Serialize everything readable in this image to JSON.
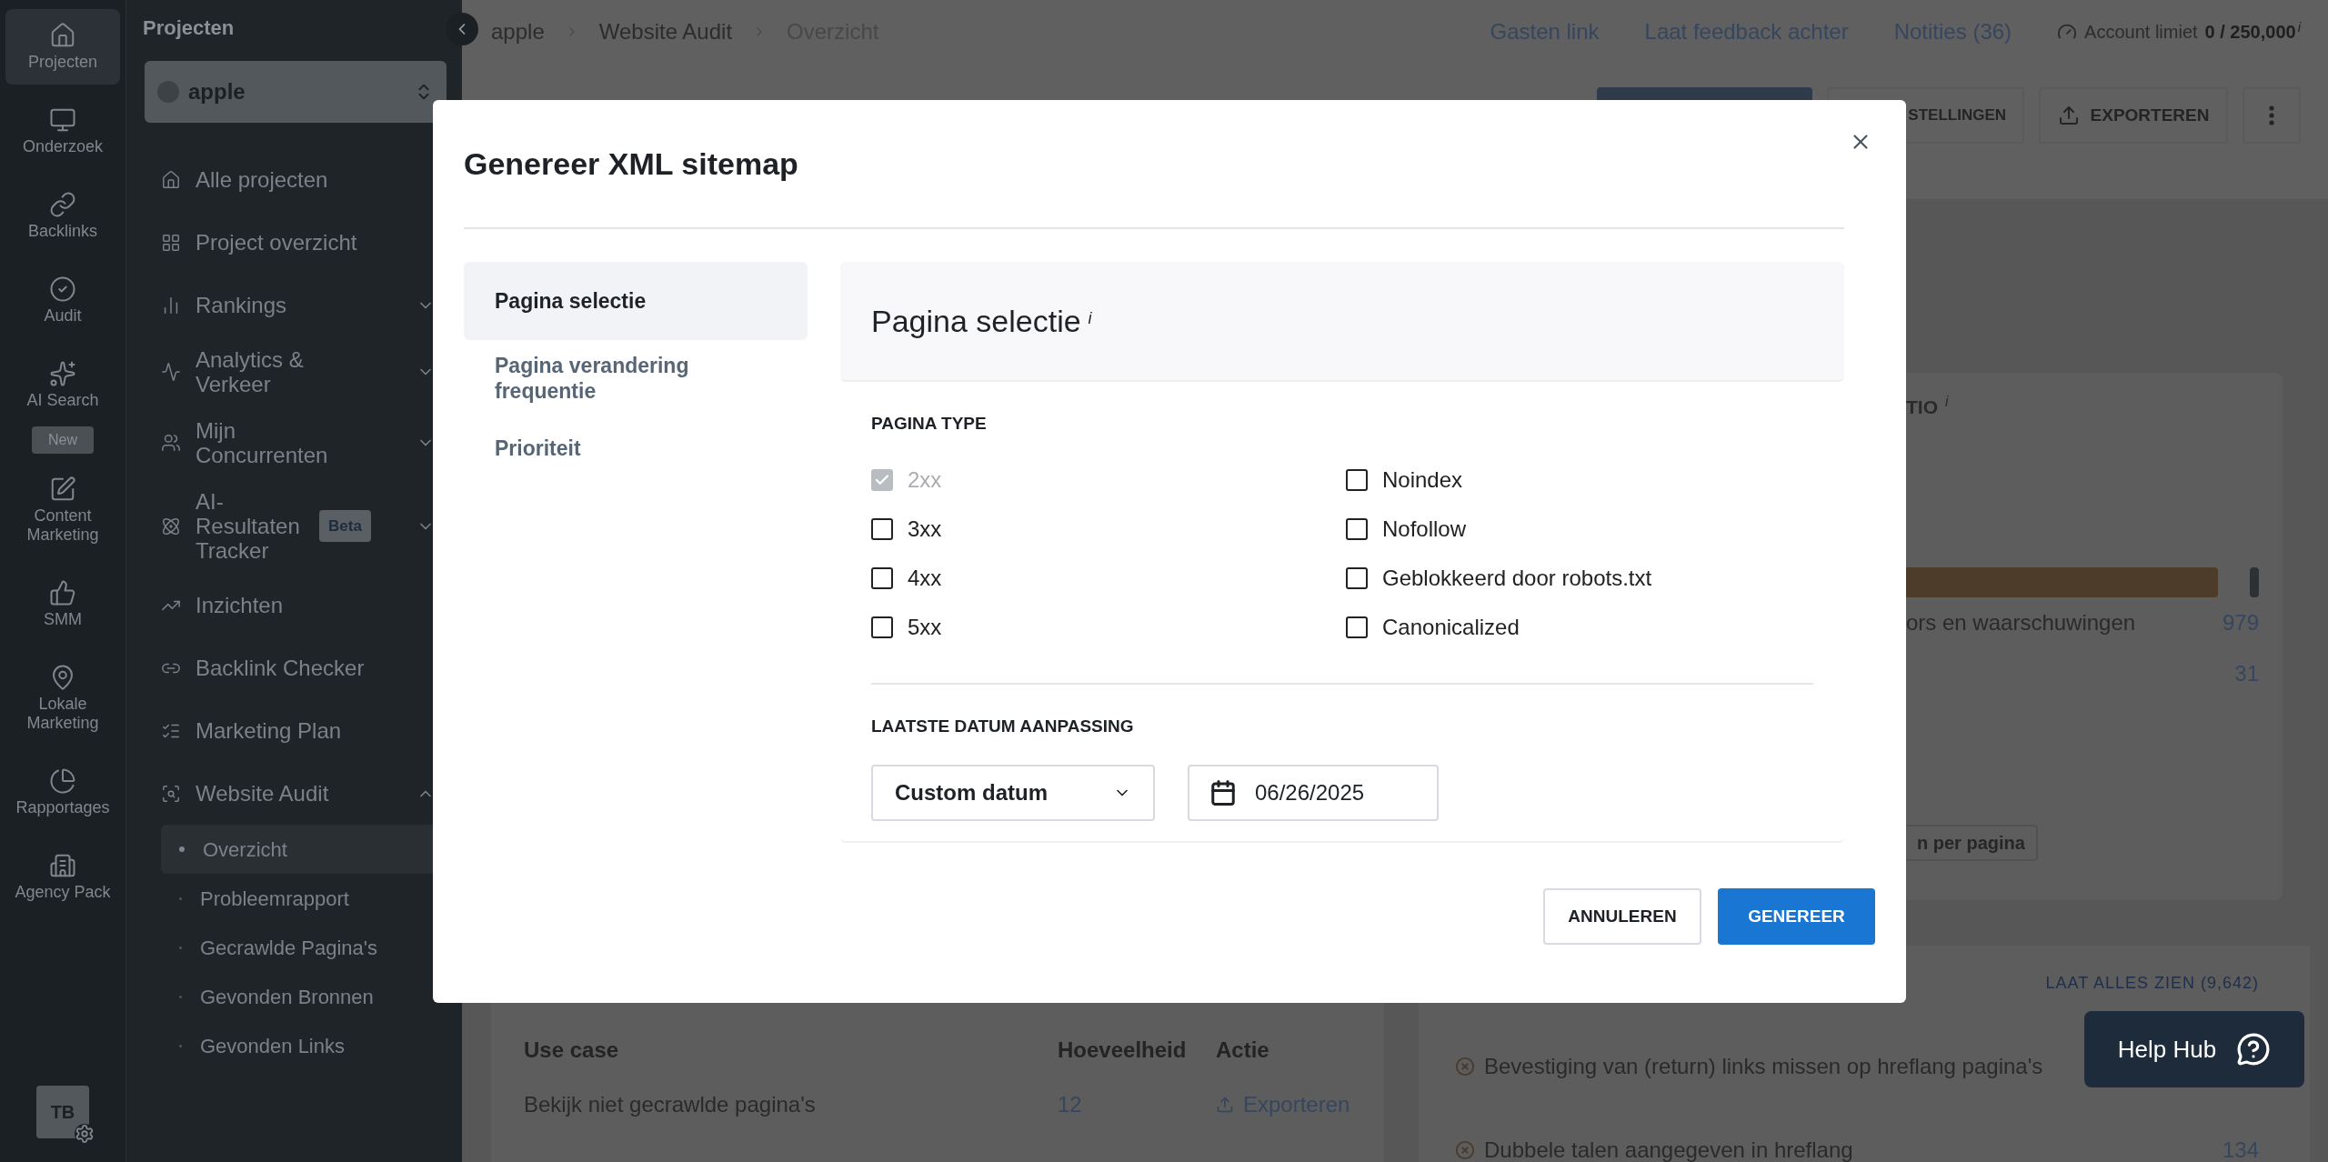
{
  "icon_rail": {
    "items": [
      {
        "label": "Projecten",
        "selected": true
      },
      {
        "label": "Onderzoek",
        "selected": false
      },
      {
        "label": "Backlinks",
        "selected": false
      },
      {
        "label": "Audit",
        "selected": false
      },
      {
        "label": "AI Search",
        "selected": false,
        "badge": "New"
      },
      {
        "label": "Content Marketing",
        "selected": false
      },
      {
        "label": "SMM",
        "selected": false
      },
      {
        "label": "Lokale Marketing",
        "selected": false
      },
      {
        "label": "Rapportages",
        "selected": false
      },
      {
        "label": "Agency Pack",
        "selected": false
      }
    ],
    "avatar": "TB"
  },
  "nav": {
    "title": "Projecten",
    "project": "apple",
    "items": [
      {
        "label": "Alle projecten"
      },
      {
        "label": "Project overzicht"
      },
      {
        "label": "Rankings",
        "expanded": false
      },
      {
        "label": "Analytics & Verkeer",
        "expanded": false
      },
      {
        "label": "Mijn Concurrenten",
        "expanded": false
      },
      {
        "label": "AI-Resultaten Tracker",
        "expanded": false,
        "badge": "Beta"
      },
      {
        "label": "Inzichten"
      },
      {
        "label": "Backlink Checker"
      },
      {
        "label": "Marketing Plan"
      },
      {
        "label": "Website Audit",
        "expanded": true,
        "children": [
          {
            "label": "Overzicht",
            "selected": true
          },
          {
            "label": "Probleemrapport",
            "selected": false
          },
          {
            "label": "Gecrawlde Pagina's",
            "selected": false
          },
          {
            "label": "Gevonden Bronnen",
            "selected": false
          },
          {
            "label": "Gevonden Links",
            "selected": false
          }
        ]
      }
    ]
  },
  "breadcrumbs": [
    "apple",
    "Website Audit",
    "Overzicht"
  ],
  "top_links": [
    "Gasten link",
    "Laat feedback achter",
    "Notities (36)"
  ],
  "account_limit": {
    "label": "Account limiet",
    "value": "0 / 250,000",
    "info": "i"
  },
  "actions": [
    "STELLINGEN",
    "EXPORTEREN"
  ],
  "issues_card": {
    "title": "TIO",
    "info": "i",
    "level": 0.93,
    "rows": [
      {
        "label": "ors en waarschuwingen",
        "value": "979"
      },
      {
        "value": "31"
      }
    ],
    "button": "n per pagina"
  },
  "use_cases": {
    "columns": [
      "Use case",
      "Hoeveelheid",
      "Actie"
    ],
    "rows": [
      {
        "use_case": "Bekijk niet gecrawlde pagina's",
        "amount": "12",
        "action": "Exporteren"
      }
    ]
  },
  "issues_list": {
    "link": "LAAT ALLES ZIEN (9,642)",
    "items": [
      {
        "label": "Bevestiging van (return) links missen op hreflang pagina's"
      },
      {
        "label": "Dubbele talen aangegeven in hreflang",
        "value": "134"
      }
    ]
  },
  "help_hub": "Help Hub",
  "modal": {
    "title": "Genereer XML sitemap",
    "tabs": [
      {
        "label": "Pagina selectie",
        "selected": true
      },
      {
        "label": "Pagina verandering frequentie",
        "selected": false
      },
      {
        "label": "Prioriteit",
        "selected": false
      }
    ],
    "panel_title": "Pagina selectie",
    "panel_info": "i",
    "page_type_label": "PAGINA TYPE",
    "page_types": [
      {
        "label": "2xx",
        "checked": true,
        "disabled": true
      },
      {
        "label": "Noindex",
        "checked": false,
        "disabled": false
      },
      {
        "label": "3xx",
        "checked": false,
        "disabled": false
      },
      {
        "label": "Nofollow",
        "checked": false,
        "disabled": false
      },
      {
        "label": "4xx",
        "checked": false,
        "disabled": false
      },
      {
        "label": "Geblokkeerd door robots.txt",
        "checked": false,
        "disabled": false
      },
      {
        "label": "5xx",
        "checked": false,
        "disabled": false
      },
      {
        "label": "Canonicalized",
        "checked": false,
        "disabled": false
      }
    ],
    "date_label": "LAATSTE DATUM AANPASSING",
    "date_mode": "Custom datum",
    "date": "06/26/2025",
    "cancel": "ANNULEREN",
    "submit": "GENEREER"
  }
}
